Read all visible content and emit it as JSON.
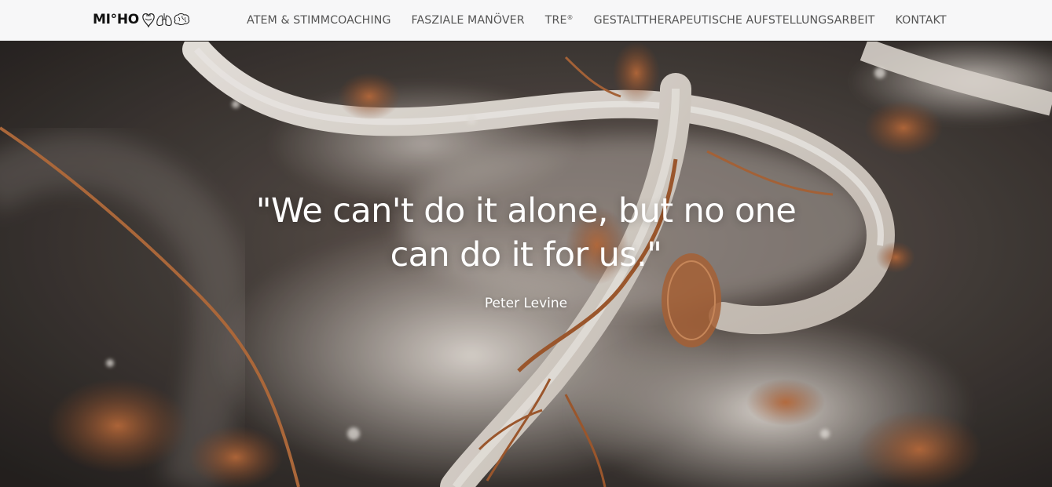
{
  "brand": {
    "name": "MI°HO",
    "icons": [
      "heart-icon",
      "lungs-icon",
      "brain-icon"
    ]
  },
  "nav": {
    "items": [
      {
        "label": "ATEM & STIMMCOACHING"
      },
      {
        "label": "FASZIALE MANÖVER"
      },
      {
        "label": "TRE",
        "sup": "®"
      },
      {
        "label": "GESTALTTHERAPEUTISCHE AUFSTELLUNGSARBEIT"
      },
      {
        "label": "KONTAKT"
      }
    ]
  },
  "hero": {
    "quote_line1": "\"We can't do it alone, but no one",
    "quote_line2": "can do it for us.\"",
    "author": "Peter Levine"
  },
  "colors": {
    "navbar_bg": "#f7f7f8",
    "nav_text": "#555555",
    "brand_text": "#111111",
    "hero_text": "#ffffff",
    "hero_copper": "#b8663a",
    "hero_cream": "#ece6df"
  }
}
